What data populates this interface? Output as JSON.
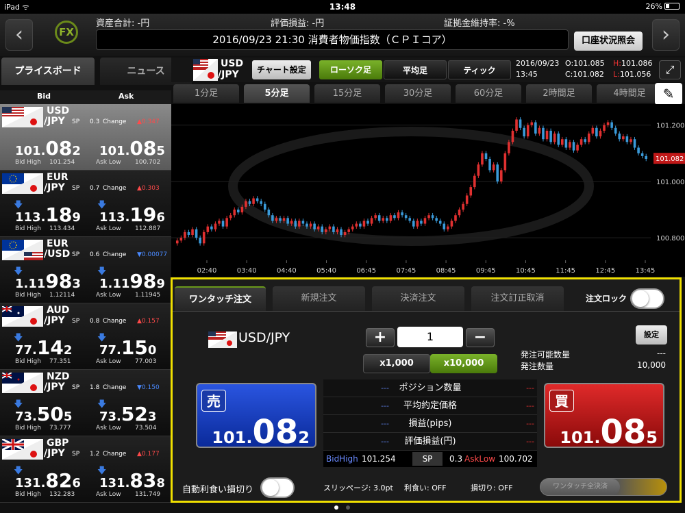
{
  "status_bar": {
    "left": "iPad ᯤ",
    "time": "13:48",
    "battery": "26%"
  },
  "header": {
    "logo": "FX",
    "total_assets": "資産合計: -円",
    "unrealized_pl": "評価損益: -円",
    "margin_ratio": "証拠金維持率: -%",
    "news": "2016/09/23 21:30 消費者物価指数（ＣＰＩコア）",
    "account_button": "口座状況照会"
  },
  "left_tabs": {
    "price_board": "プライスボード",
    "news": "ニュース"
  },
  "price_board": {
    "bid_header": "Bid",
    "ask_header": "Ask",
    "rows": [
      {
        "base": "USD",
        "quote": "/JPY",
        "sp_label": "SP",
        "sp": "0.3",
        "change_label": "Change",
        "change": "▲0.347",
        "bid": {
          "a": "101.",
          "b": "08",
          "c": "2"
        },
        "ask": {
          "a": "101.",
          "b": "08",
          "c": "5"
        },
        "bid_high_label": "Bid High",
        "bid_high": "101.254",
        "ask_low_label": "Ask Low",
        "ask_low": "100.702"
      },
      {
        "base": "EUR",
        "quote": "/JPY",
        "sp_label": "SP",
        "sp": "0.7",
        "change_label": "Change",
        "change": "▲0.303",
        "bid": {
          "a": "113.",
          "b": "18",
          "c": "9"
        },
        "ask": {
          "a": "113.",
          "b": "19",
          "c": "6"
        },
        "bid_high_label": "Bid High",
        "bid_high": "113.434",
        "ask_low_label": "Ask Low",
        "ask_low": "112.887"
      },
      {
        "base": "EUR",
        "quote": "/USD",
        "sp_label": "SP",
        "sp": "0.6",
        "change_label": "Change",
        "change": "▼0.00077",
        "bid": {
          "a": "1.11",
          "b": "98",
          "c": "3"
        },
        "ask": {
          "a": "1.11",
          "b": "98",
          "c": "9"
        },
        "bid_high_label": "Bid High",
        "bid_high": "1.12114",
        "ask_low_label": "Ask Low",
        "ask_low": "1.11945"
      },
      {
        "base": "AUD",
        "quote": "/JPY",
        "sp_label": "SP",
        "sp": "0.8",
        "change_label": "Change",
        "change": "▲0.157",
        "bid": {
          "a": "77.",
          "b": "14",
          "c": "2"
        },
        "ask": {
          "a": "77.",
          "b": "15",
          "c": "0"
        },
        "bid_high_label": "Bid High",
        "bid_high": "77.351",
        "ask_low_label": "Ask Low",
        "ask_low": "77.003"
      },
      {
        "base": "NZD",
        "quote": "/JPY",
        "sp_label": "SP",
        "sp": "1.8",
        "change_label": "Change",
        "change": "▼0.150",
        "bid": {
          "a": "73.",
          "b": "50",
          "c": "5"
        },
        "ask": {
          "a": "73.",
          "b": "52",
          "c": "3"
        },
        "bid_high_label": "Bid High",
        "bid_high": "73.777",
        "ask_low_label": "Ask Low",
        "ask_low": "73.504"
      },
      {
        "base": "GBP",
        "quote": "/JPY",
        "sp_label": "SP",
        "sp": "1.2",
        "change_label": "Change",
        "change": "▲0.177",
        "bid": {
          "a": "131.",
          "b": "82",
          "c": "6"
        },
        "ask": {
          "a": "131.",
          "b": "83",
          "c": "8"
        },
        "bid_high_label": "Bid High",
        "bid_high": "132.283",
        "ask_low_label": "Ask Low",
        "ask_low": "131.749"
      }
    ]
  },
  "chart_toolbar": {
    "pair_base": "USD",
    "pair_quote": "/JPY",
    "chart_settings": "チャート設定",
    "candles": "ローソク足",
    "moving_avg": "平均足",
    "tick": "ティック",
    "date": "2016/09/23",
    "time": "13:45",
    "o_label": "O:",
    "o": "101.085",
    "h_label": "H:",
    "h": "101.086",
    "c_label": "C:",
    "c": "101.082",
    "l_label": "L:",
    "l": "101.056"
  },
  "timeframes": [
    "1分足",
    "5分足",
    "15分足",
    "30分足",
    "60分足",
    "2時間足",
    "4時間足"
  ],
  "timeframe_selected": "5分足",
  "chart_data": {
    "type": "candlestick",
    "x_ticks": [
      "02:40",
      "03:40",
      "04:40",
      "05:40",
      "06:45",
      "07:45",
      "08:45",
      "09:45",
      "10:45",
      "11:45",
      "12:45",
      "13:45"
    ],
    "y_ticks": [
      101.2,
      101.0,
      100.8
    ],
    "ylim": [
      100.72,
      101.26
    ],
    "current_price": "101.082",
    "close_series": [
      100.79,
      100.8,
      100.82,
      100.81,
      100.83,
      100.8,
      100.78,
      100.82,
      100.84,
      100.83,
      100.85,
      100.86,
      100.84,
      100.87,
      100.88,
      100.9,
      100.89,
      100.91,
      100.93,
      100.92,
      100.94,
      100.93,
      100.92,
      100.9,
      100.88,
      100.86,
      100.87,
      100.86,
      100.87,
      100.85,
      100.86,
      100.84,
      100.86,
      100.85,
      100.84,
      100.85,
      100.83,
      100.84,
      100.82,
      100.83,
      100.84,
      100.82,
      100.83,
      100.81,
      100.82,
      100.83,
      100.84,
      100.85,
      100.84,
      100.86,
      100.85,
      100.87,
      100.88,
      100.86,
      100.87,
      100.86,
      100.88,
      100.87,
      100.89,
      100.88,
      100.87,
      100.86,
      100.84,
      100.86,
      100.85,
      100.87,
      100.88,
      100.87,
      100.86,
      100.85,
      100.83,
      100.84,
      100.86,
      100.88,
      100.9,
      100.92,
      100.95,
      100.98,
      101.02,
      101.06,
      101.1,
      101.08,
      101.04,
      101.06,
      101.0,
      101.04,
      101.1,
      101.14,
      101.18,
      101.22,
      101.19,
      101.16,
      101.2,
      101.21,
      101.17,
      101.19,
      101.15,
      101.18,
      101.14,
      101.17,
      101.13,
      101.15,
      101.12,
      101.14,
      101.11,
      101.13,
      101.15,
      101.14,
      101.17,
      101.19,
      101.16,
      101.18,
      101.2,
      101.21,
      101.19,
      101.17,
      101.15,
      101.16,
      101.14,
      101.15,
      101.12,
      101.1,
      101.09,
      101.08
    ]
  },
  "order_panel": {
    "tabs": [
      "ワンタッチ注文",
      "新規注文",
      "決済注文",
      "注文訂正取消"
    ],
    "order_lock_label": "注文ロック",
    "pair": "USD/JPY",
    "plus": "+",
    "quantity": "1",
    "minus": "−",
    "settings": "設定",
    "x1000": "x1,000",
    "x10000": "x10,000",
    "available_label": "発注可能数量",
    "available_value": "---",
    "order_qty_label": "発注数量",
    "order_qty_value": "10,000",
    "sell_label": "売",
    "sell_price": {
      "a": "101.",
      "b": "08",
      "c": "2"
    },
    "buy_label": "買",
    "buy_price": {
      "a": "101.",
      "b": "08",
      "c": "5"
    },
    "info_rows": [
      {
        "label": "ポジション数量",
        "l": "---",
        "r": "---"
      },
      {
        "label": "平均約定価格",
        "l": "---",
        "r": "---"
      },
      {
        "label": "損益(pips)",
        "l": "---",
        "r": "---"
      },
      {
        "label": "評価損益(円)",
        "l": "---",
        "r": "---"
      }
    ],
    "bid_high_label": "BidHigh",
    "bid_high": "101.254",
    "sp_label": "SP",
    "sp": "0.3",
    "ask_low_label": "AskLow",
    "ask_low": "100.702",
    "auto_stop_label": "自動利食い損切り",
    "slippage": "スリッページ: 3.0pt",
    "take_profit": "利食い: OFF",
    "stop_loss": "損切り: OFF",
    "close_all": "ワンタッチ全決済"
  },
  "colors": {
    "accent_green": "#6a9a1a",
    "bid_blue": "#1a3fc8",
    "ask_red": "#c81a1a",
    "highlight_yellow": "#f0e000"
  }
}
